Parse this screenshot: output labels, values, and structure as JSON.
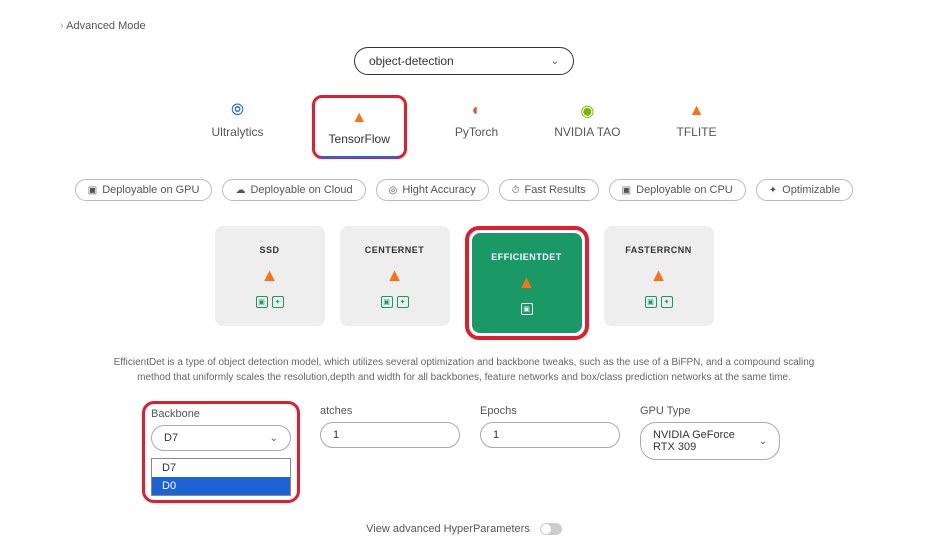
{
  "breadcrumb": "Advanced Mode",
  "task_select": {
    "value": "object-detection"
  },
  "frameworks": [
    {
      "label": "Ultralytics",
      "icon": "🔵",
      "active": false
    },
    {
      "label": "TensorFlow",
      "icon": "⬆",
      "active": true,
      "highlight": true
    },
    {
      "label": "PyTorch",
      "icon": "🔥",
      "active": false
    },
    {
      "label": "NVIDIA TAO",
      "icon": "👁",
      "active": false
    },
    {
      "label": "TFLITE",
      "icon": "⬆",
      "active": false
    }
  ],
  "filters": [
    {
      "label": "Deployable on GPU"
    },
    {
      "label": "Deployable on Cloud"
    },
    {
      "label": "Hight Accuracy"
    },
    {
      "label": "Fast Results"
    },
    {
      "label": "Deployable on CPU"
    },
    {
      "label": "Optimizable"
    }
  ],
  "models": [
    {
      "label": "SSD",
      "selected": false
    },
    {
      "label": "CENTERNET",
      "selected": false
    },
    {
      "label": "EFFICIENTDET",
      "selected": true,
      "highlight": true
    },
    {
      "label": "FASTERRCNN",
      "selected": false
    }
  ],
  "description": "EfficientDet is a type of object detection model, which utilizes several optimization and backbone tweaks, such as the use of a BiFPN, and a compound scaling method that uniformly scales the resolution,depth and width for all backbones, feature networks and box/class prediction networks at the same time.",
  "params": {
    "backbone": {
      "label": "Backbone",
      "value": "D7",
      "options": [
        "D7",
        "D0"
      ],
      "open": true,
      "highlight": true
    },
    "batches": {
      "label": "atches",
      "value": "1"
    },
    "epochs": {
      "label": "Epochs",
      "value": "1"
    },
    "gpu": {
      "label": "GPU Type",
      "value": "NVIDIA GeForce RTX 309"
    }
  },
  "advanced_hp": {
    "label": "View advanced HyperParameters"
  }
}
